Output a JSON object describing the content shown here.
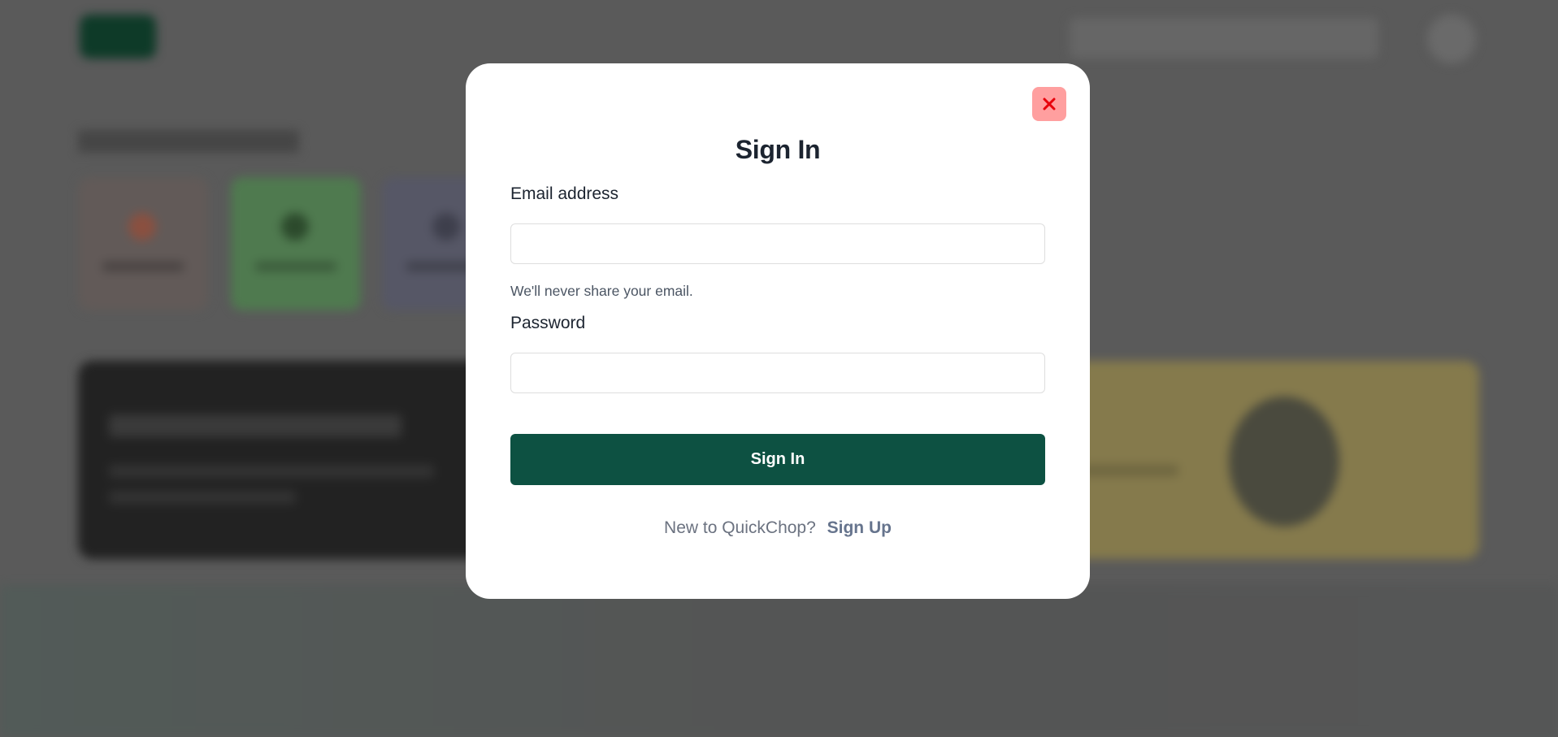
{
  "modal": {
    "title": "Sign In",
    "close_icon": "close-icon",
    "email_label": "Email address",
    "email_value": "",
    "email_help": "We'll never share your email.",
    "password_label": "Password",
    "password_value": "",
    "submit_label": "Sign In",
    "signup_prompt": "New to QuickChop?",
    "signup_link": "Sign Up"
  },
  "colors": {
    "overlay": "#5a5a5a",
    "primary_button": "#0d5142",
    "close_button_bg": "#ff9f9f",
    "close_icon": "#e8000b",
    "signup_link": "#66748d"
  }
}
